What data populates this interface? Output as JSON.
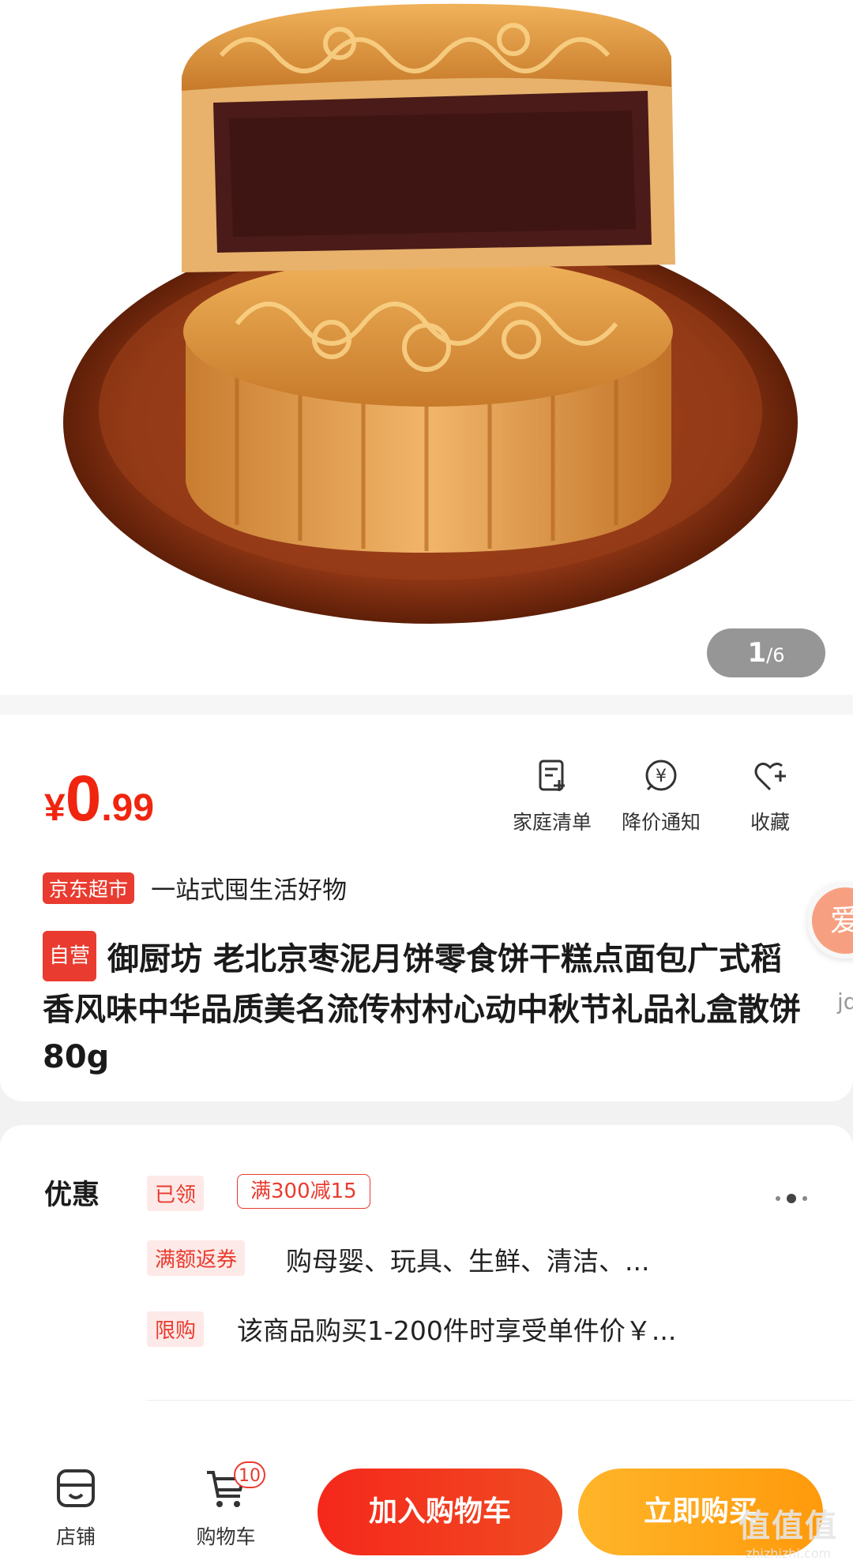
{
  "gallery": {
    "current": "1",
    "total": "/6",
    "image_alt": "product-mooncake-photo"
  },
  "price": {
    "symbol": "¥",
    "integer": "0",
    "decimal": ".99"
  },
  "actions": [
    {
      "label": "家庭清单",
      "icon": "list-add-icon"
    },
    {
      "label": "降价通知",
      "icon": "price-drop-icon"
    },
    {
      "label": "收藏",
      "icon": "heart-add-icon"
    }
  ],
  "store": {
    "tag": "京东超市",
    "slogan": "一站式囤生活好物"
  },
  "product": {
    "tag": "自营",
    "title": "御厨坊 老北京枣泥月饼零食饼干糕点面包广式稻香风味中华品质美名流传村村心动中秋节礼品礼盒散饼80g"
  },
  "side_badge": {
    "text": "爱",
    "sub": "jd"
  },
  "promotions": {
    "title": "优惠",
    "claimed_tag": "已领",
    "coupon": "满300减15",
    "rebate_tag": "满额返券",
    "rebate_text": "购母婴、玩具、生鲜、清洁、...",
    "limit_tag": "限购",
    "limit_text": "该商品购买1-200件时享受单件价￥..."
  },
  "bottom_bar": {
    "store_label": "店铺",
    "cart_label": "购物车",
    "cart_count": "10",
    "add_to_cart": "加入购物车",
    "buy_now": "立即购买"
  },
  "watermark": {
    "big": "值值值",
    "small": "zhizhizhi.com"
  },
  "colors": {
    "accent_red": "#f0250f",
    "buy_orange": "#ff9a0b"
  }
}
